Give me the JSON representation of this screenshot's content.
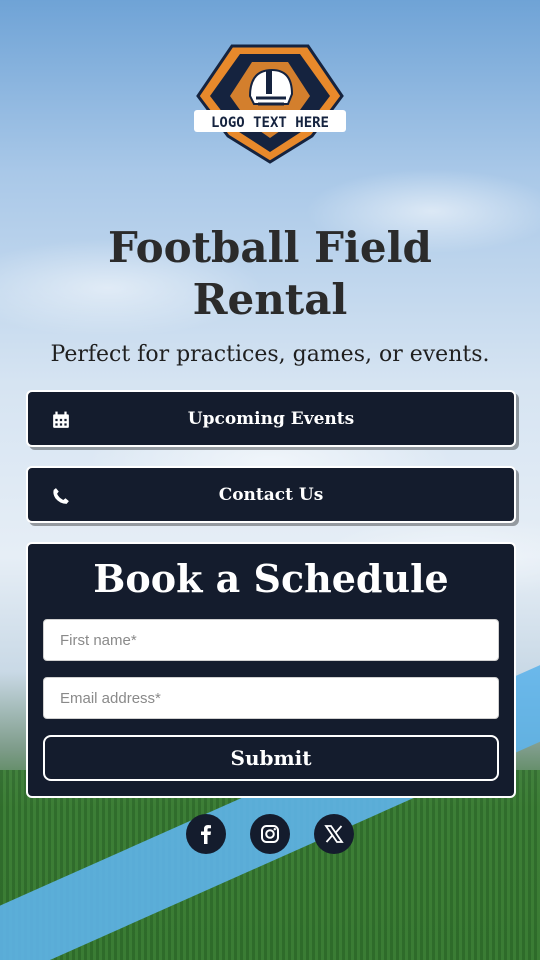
{
  "logo": {
    "text": "LOGO TEXT HERE",
    "icon": "football-helmet-icon",
    "colors": {
      "orange": "#e8892b",
      "navy": "#15233f"
    }
  },
  "hero": {
    "title_line1": "Football Field",
    "title_line2": "Rental",
    "subtitle": "Perfect for practices, games, or events."
  },
  "buttons": {
    "events": {
      "label": "Upcoming Events",
      "icon": "calendar-icon"
    },
    "contact": {
      "label": "Contact Us",
      "icon": "phone-icon"
    }
  },
  "form": {
    "title": "Book a Schedule",
    "first_name_placeholder": "First name*",
    "email_placeholder": "Email address*",
    "submit_label": "Submit"
  },
  "social": [
    {
      "name": "facebook",
      "icon": "facebook-icon"
    },
    {
      "name": "instagram",
      "icon": "instagram-icon"
    },
    {
      "name": "x",
      "icon": "x-icon"
    }
  ],
  "colors": {
    "panel": "#141c2d",
    "text_dark": "#2b2b2b",
    "white": "#ffffff"
  }
}
